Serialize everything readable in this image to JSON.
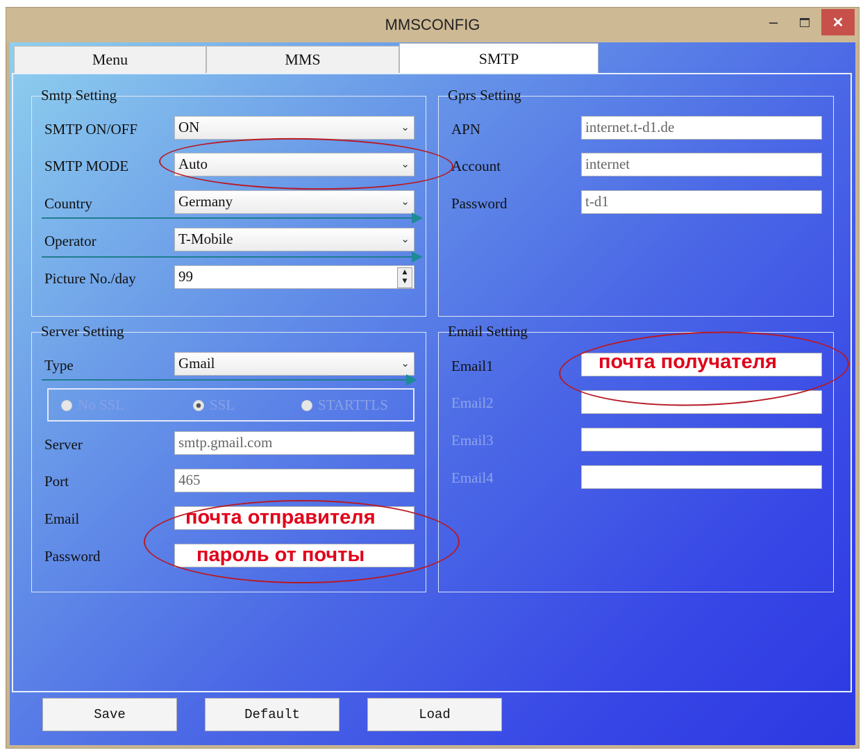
{
  "window": {
    "title": "MMSCONFIG",
    "minimize": "‒",
    "close": "✕"
  },
  "tabs": [
    {
      "label": "Menu"
    },
    {
      "label": "MMS"
    },
    {
      "label": "SMTP"
    }
  ],
  "smtp_setting": {
    "legend": "Smtp Setting",
    "on_off_label": "SMTP ON/OFF",
    "on_off_value": "ON",
    "mode_label": "SMTP MODE",
    "mode_value": "Auto",
    "country_label": "Country",
    "country_value": "Germany",
    "operator_label": "Operator",
    "operator_value": "T-Mobile",
    "picture_label": "Picture No./day",
    "picture_value": "99"
  },
  "gprs_setting": {
    "legend": "Gprs Setting",
    "apn_label": "APN",
    "apn_value": "internet.t-d1.de",
    "account_label": "Account",
    "account_value": "internet",
    "password_label": "Password",
    "password_value": "t-d1"
  },
  "server_setting": {
    "legend": "Server Setting",
    "type_label": "Type",
    "type_value": "Gmail",
    "ssl_options": [
      "No SSL",
      "SSL",
      "STARTTLS"
    ],
    "ssl_selected": "SSL",
    "server_label": "Server",
    "server_value": "smtp.gmail.com",
    "port_label": "Port",
    "port_value": "465",
    "email_label": "Email",
    "password_label": "Password"
  },
  "email_setting": {
    "legend": "Email Setting",
    "email1_label": "Email1",
    "email2_label": "Email2",
    "email3_label": "Email3",
    "email4_label": "Email4"
  },
  "annotations": {
    "recipient": "почта получателя",
    "sender": "почта отправителя",
    "password": "пароль от почты"
  },
  "buttons": {
    "save": "Save",
    "default": "Default",
    "load": "Load"
  },
  "icons": {
    "dropdown": "chevron-down-icon",
    "spinner": "spinner-icon"
  },
  "colors": {
    "annotation": "#e1001a",
    "close_button": "#c7514a"
  }
}
